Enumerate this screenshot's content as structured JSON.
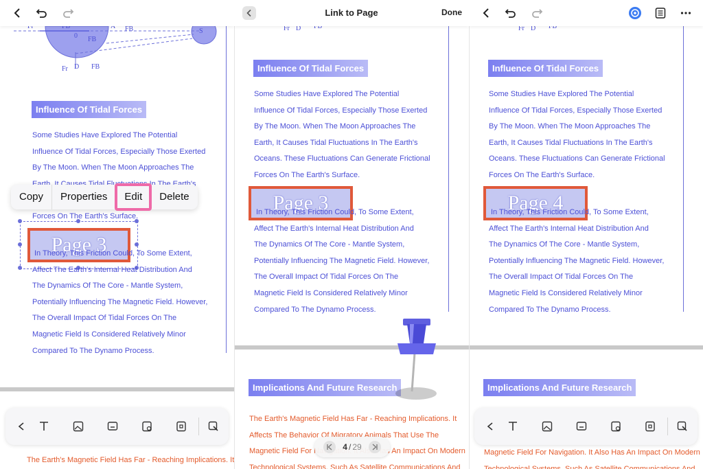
{
  "panel1": {
    "heading": "Influence Of Tidal Forces",
    "para1": [
      "Some Studies Have Explored The Potential",
      "Influence Of Tidal Forces, Especially Those Exerted",
      "By The Moon. When The Moon Approaches The",
      "Earth, It Causes Tidal Fluctuations In The Earth's"
    ],
    "para1_last": "Forces On The Earth's Surface.",
    "link_label": "Page 3",
    "para2": [
      "In Theory, This Friction Could, To Some Extent,",
      "Affect The Earth's Internal Heat Distribution And",
      "The Dynamics Of The Core - Mantle System,",
      "Potentially Influencing The Magnetic Field. However,",
      "The Overall Impact Of Tidal Forces On The",
      "Magnetic Field Is Considered Relatively Minor",
      "Compared To The Dynamo Process."
    ],
    "bottom_text": "The Earth's Magnetic Field Has Far - Reaching Implications. It",
    "diagram_labels": [
      "Fr",
      "D",
      "FB",
      "0",
      "FB",
      "A",
      "FB",
      "S",
      "Fr",
      "D",
      "FB"
    ],
    "context_menu": {
      "copy": "Copy",
      "properties": "Properties",
      "edit": "Edit",
      "delete": "Delete"
    }
  },
  "panel2": {
    "title": "Link to Page",
    "done": "Done",
    "diagram_labels": [
      "Fr",
      "D",
      "FB"
    ],
    "heading": "Influence Of Tidal Forces",
    "para1": [
      "Some Studies Have Explored The Potential",
      "Influence Of Tidal Forces, Especially Those Exerted",
      "By The Moon. When The Moon Approaches The",
      "Earth, It Causes Tidal Fluctuations In The Earth's",
      "Oceans. These Fluctuations Can Generate Frictional",
      "Forces On The Earth's Surface."
    ],
    "link_label": "Page 3",
    "para2": [
      "In Theory, This Friction Could, To Some Extent,",
      "Affect The Earth's Internal Heat Distribution And",
      "The Dynamics Of The Core - Mantle System,",
      "Potentially Influencing The Magnetic Field. However,",
      "The Overall Impact Of Tidal Forces On The",
      "Magnetic Field Is Considered Relatively Minor",
      "Compared To The Dynamo Process."
    ],
    "heading2": "Implications And Future Research",
    "para3": [
      "The Earth's Magnetic Field Has Far - Reaching Implications. It",
      "Affects The Behavior Of Migratory Animals That Use The",
      "Magnetic Field For Navigation. It Also Has An Impact On Modern",
      "Technological Systems, Such As Satellite Communications And"
    ],
    "page_current": "4",
    "page_total": "29"
  },
  "panel3": {
    "diagram_labels": [
      "Fr",
      "D",
      "FB"
    ],
    "heading": "Influence Of Tidal Forces",
    "para1": [
      "Some Studies Have Explored The Potential",
      "Influence Of Tidal Forces, Especially Those Exerted",
      "By The Moon. When The Moon Approaches The",
      "Earth, It Causes Tidal Fluctuations In The Earth's",
      "Oceans. These Fluctuations Can Generate Frictional",
      "Forces On The Earth's Surface."
    ],
    "link_label": "Page 4",
    "para2": [
      "In Theory, This Friction Could, To Some Extent,",
      "Affect The Earth's Internal Heat Distribution And",
      "The Dynamics Of The Core - Mantle System,",
      "Potentially Influencing The Magnetic Field. However,",
      "The Overall Impact Of Tidal Forces On The",
      "Magnetic Field Is Considered Relatively Minor",
      "Compared To The Dynamo Process."
    ],
    "heading2": "Implications And Future Research",
    "para3": [
      "Magnetic Field For Navigation. It Also Has An Impact On Modern",
      "Technological Systems, Such As Satellite Communications And"
    ]
  },
  "icons": {
    "back": "chevron-left-icon",
    "undo": "undo-icon",
    "redo": "redo-icon",
    "ai": "ai-assistant-icon",
    "outline": "outline-icon",
    "more": "more-icon",
    "text": "text-icon",
    "image": "image-icon",
    "link": "link-icon",
    "edit_doc": "edit-document-icon",
    "ocr": "ocr-icon",
    "pin": "push-pin-icon"
  },
  "colors": {
    "text_blue": "#4b4fd6",
    "text_orange": "#e35a2b",
    "link_border": "#e0593a",
    "highlight_pink": "#ee6aa8"
  }
}
